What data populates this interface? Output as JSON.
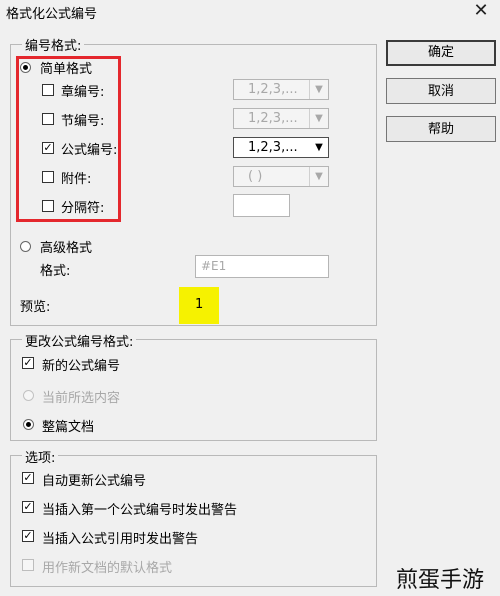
{
  "window": {
    "title": "格式化公式编号",
    "close": "✕"
  },
  "buttons": {
    "ok": "确定",
    "cancel": "取消",
    "help": "帮助"
  },
  "numbering_format": {
    "legend": "编号格式:",
    "simple": {
      "label": "简单格式",
      "selected": true
    },
    "rows": [
      {
        "label": "章编号:",
        "checked": false,
        "value": "1,2,3,...",
        "enabled": false
      },
      {
        "label": "节编号:",
        "checked": false,
        "value": "1,2,3,...",
        "enabled": false
      },
      {
        "label": "公式编号:",
        "checked": true,
        "value": "1,2,3,...",
        "enabled": true
      },
      {
        "label": "附件:",
        "checked": false,
        "value": "( )",
        "enabled": false
      },
      {
        "label": "分隔符:",
        "checked": false,
        "value": "",
        "enabled": false
      }
    ],
    "advanced": {
      "label": "高级格式",
      "selected": false
    },
    "format_label": "格式:",
    "format_placeholder": "#E1",
    "preview_label": "预览:",
    "preview_value": "1"
  },
  "change_format": {
    "legend": "更改公式编号格式:",
    "new_numbers": {
      "label": "新的公式编号",
      "checked": true
    },
    "current_selection": {
      "label": "当前所选内容",
      "enabled": false
    },
    "whole_document": {
      "label": "整篇文档",
      "selected": true
    }
  },
  "options": {
    "legend": "选项:",
    "items": [
      {
        "label": "自动更新公式编号",
        "checked": true,
        "enabled": true
      },
      {
        "label": "当插入第一个公式编号时发出警告",
        "checked": true,
        "enabled": true
      },
      {
        "label": "当插入公式引用时发出警告",
        "checked": true,
        "enabled": true
      },
      {
        "label": "用作新文档的默认格式",
        "checked": false,
        "enabled": false
      }
    ]
  },
  "watermark": "煎蛋手游",
  "colors": {
    "annotation_red": "#e4272d",
    "highlight_yellow": "#f6f200"
  }
}
